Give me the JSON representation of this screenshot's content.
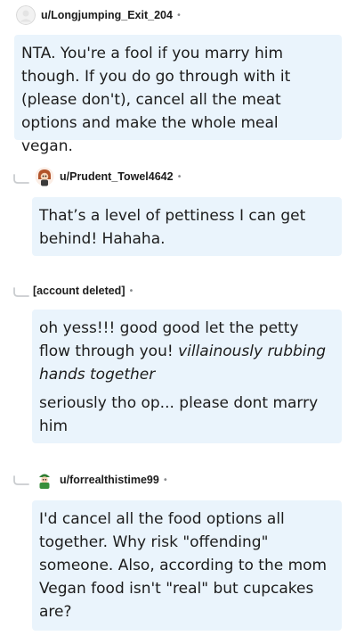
{
  "comments": [
    {
      "username": "u/Longjumping_Exit_204",
      "separator": "•",
      "paragraphs": [
        "NTA. You're a fool if you marry him though. If you do go through with it (please don't), cancel all the meat options and make the whole meal vegan."
      ]
    },
    {
      "username": "u/Prudent_Towel4642",
      "separator": "•",
      "paragraphs": [
        "That’s a level of pettiness I can get behind! Hahaha."
      ]
    },
    {
      "username": "[account deleted]",
      "separator": "•",
      "p1_text": "oh yess!!! good good let the petty flow through you! ",
      "p1_italic": "villainously rubbing hands together",
      "p2_text": "seriously tho op... please dont marry him"
    },
    {
      "username": "u/forrealthistime99",
      "separator": "•",
      "paragraphs": [
        "I'd cancel all the food options all together. Why risk \"offending\" someone. Also, according to the mom Vegan food isn't \"real\" but cupcakes are?"
      ]
    }
  ],
  "colors": {
    "bubble_bg": "#eaf4fc",
    "username": "#1c1c1c",
    "meta": "#878a8c",
    "thread_line": "#c9cccf"
  },
  "icons": {
    "reply_connector": "reply-arrow-icon",
    "avatar": "user-avatar-icon"
  }
}
